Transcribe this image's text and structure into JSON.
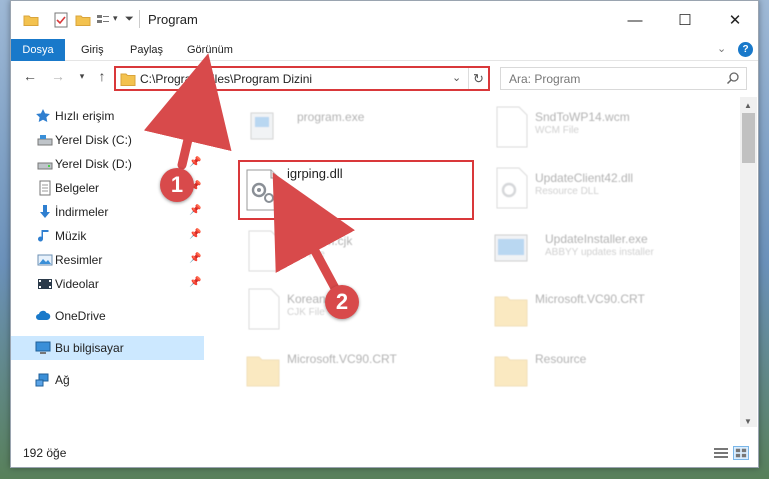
{
  "window": {
    "title": "Program",
    "controls": {
      "minimize": "—",
      "maximize": "☐",
      "close": "✕"
    }
  },
  "ribbon": {
    "tabs": [
      "Dosya",
      "Giriş",
      "Paylaş",
      "Görünüm"
    ]
  },
  "address": {
    "path": "C:\\Program Files\\Program Dizini",
    "search_placeholder": "Ara: Program"
  },
  "sidebar": {
    "quick_access": "Hızlı erişim",
    "items": [
      {
        "label": "Yerel Disk (C:)",
        "icon": "drive-icon"
      },
      {
        "label": "Yerel Disk (D:)",
        "icon": "drive-icon"
      },
      {
        "label": "Belgeler",
        "icon": "documents-icon"
      },
      {
        "label": "İndirmeler",
        "icon": "downloads-icon"
      },
      {
        "label": "Müzik",
        "icon": "music-icon"
      },
      {
        "label": "Resimler",
        "icon": "pictures-icon"
      },
      {
        "label": "Videolar",
        "icon": "videos-icon"
      }
    ],
    "onedrive": "OneDrive",
    "this_pc": "Bu bilgisayar",
    "network": "Ağ"
  },
  "files": {
    "left": [
      {
        "name": "program.exe",
        "sub": ""
      },
      {
        "name": "igrping.dll",
        "sub": ""
      },
      {
        "name": "FileForm.cjk",
        "sub": "CJK File"
      },
      {
        "name": "Korean",
        "sub": "CJK File"
      },
      {
        "name": "Microsoft.VC90.CRT",
        "sub": ""
      }
    ],
    "right": [
      {
        "name": "SndToWP14.wcm",
        "sub": "WCM File"
      },
      {
        "name": "UpdateClient42.dll",
        "sub": "Resource DLL"
      },
      {
        "name": "UpdateInstaller.exe",
        "sub": "ABBYY updates installer"
      },
      {
        "name": "Microsoft.VC90.CRT",
        "sub": ""
      },
      {
        "name": "Resource",
        "sub": ""
      }
    ]
  },
  "status": {
    "count": "192 öğe"
  },
  "markers": {
    "first": "1",
    "second": "2"
  },
  "colors": {
    "accent": "#1979ca",
    "highlight": "#d9383a",
    "marker": "#d84a4b"
  }
}
